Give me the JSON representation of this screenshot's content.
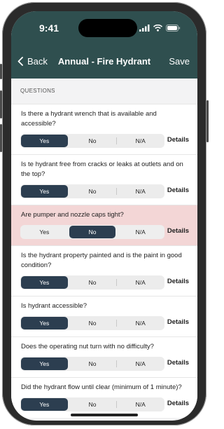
{
  "status": {
    "time": "9:41"
  },
  "nav": {
    "back_label": "Back",
    "title": "Annual - Fire Hydrant",
    "save_label": "Save"
  },
  "section": {
    "header": "QUESTIONS"
  },
  "questions": [
    {
      "text": "Is there a hydrant wrench that is available and accessible?",
      "options": [
        "Yes",
        "No",
        "N/A"
      ],
      "selected": "Yes",
      "details_label": "Details"
    },
    {
      "text": "Is te hydrant free from cracks or leaks at outlets and on the top?",
      "options": [
        "Yes",
        "No",
        "N/A"
      ],
      "selected": "Yes",
      "details_label": "Details"
    },
    {
      "text": "Are pumper and nozzle caps tight?",
      "options": [
        "Yes",
        "No",
        "N/A"
      ],
      "selected": "No",
      "details_label": "Details"
    },
    {
      "text": "Is the hydrant property painted and is the paint in good condition?",
      "options": [
        "Yes",
        "No",
        "N/A"
      ],
      "selected": "Yes",
      "details_label": "Details"
    },
    {
      "text": "Is hydrant accessible?",
      "options": [
        "Yes",
        "No",
        "N/A"
      ],
      "selected": "Yes",
      "details_label": "Details"
    },
    {
      "text": "Does the operating nut turn with no difficulty?",
      "options": [
        "Yes",
        "No",
        "N/A"
      ],
      "selected": "Yes",
      "details_label": "Details"
    },
    {
      "text": "Did the hydrant flow until clear (minimum of 1 minute)?",
      "options": [
        "Yes",
        "No",
        "N/A"
      ],
      "selected": "Yes",
      "details_label": "Details"
    }
  ],
  "colors": {
    "header_bg": "#2f4f4f",
    "selected_segment": "#2c3e50",
    "flag_row_bg": "#f3d6d6"
  },
  "icons": [
    "cellular-signal-icon",
    "wifi-icon",
    "battery-icon",
    "chevron-left-icon"
  ]
}
